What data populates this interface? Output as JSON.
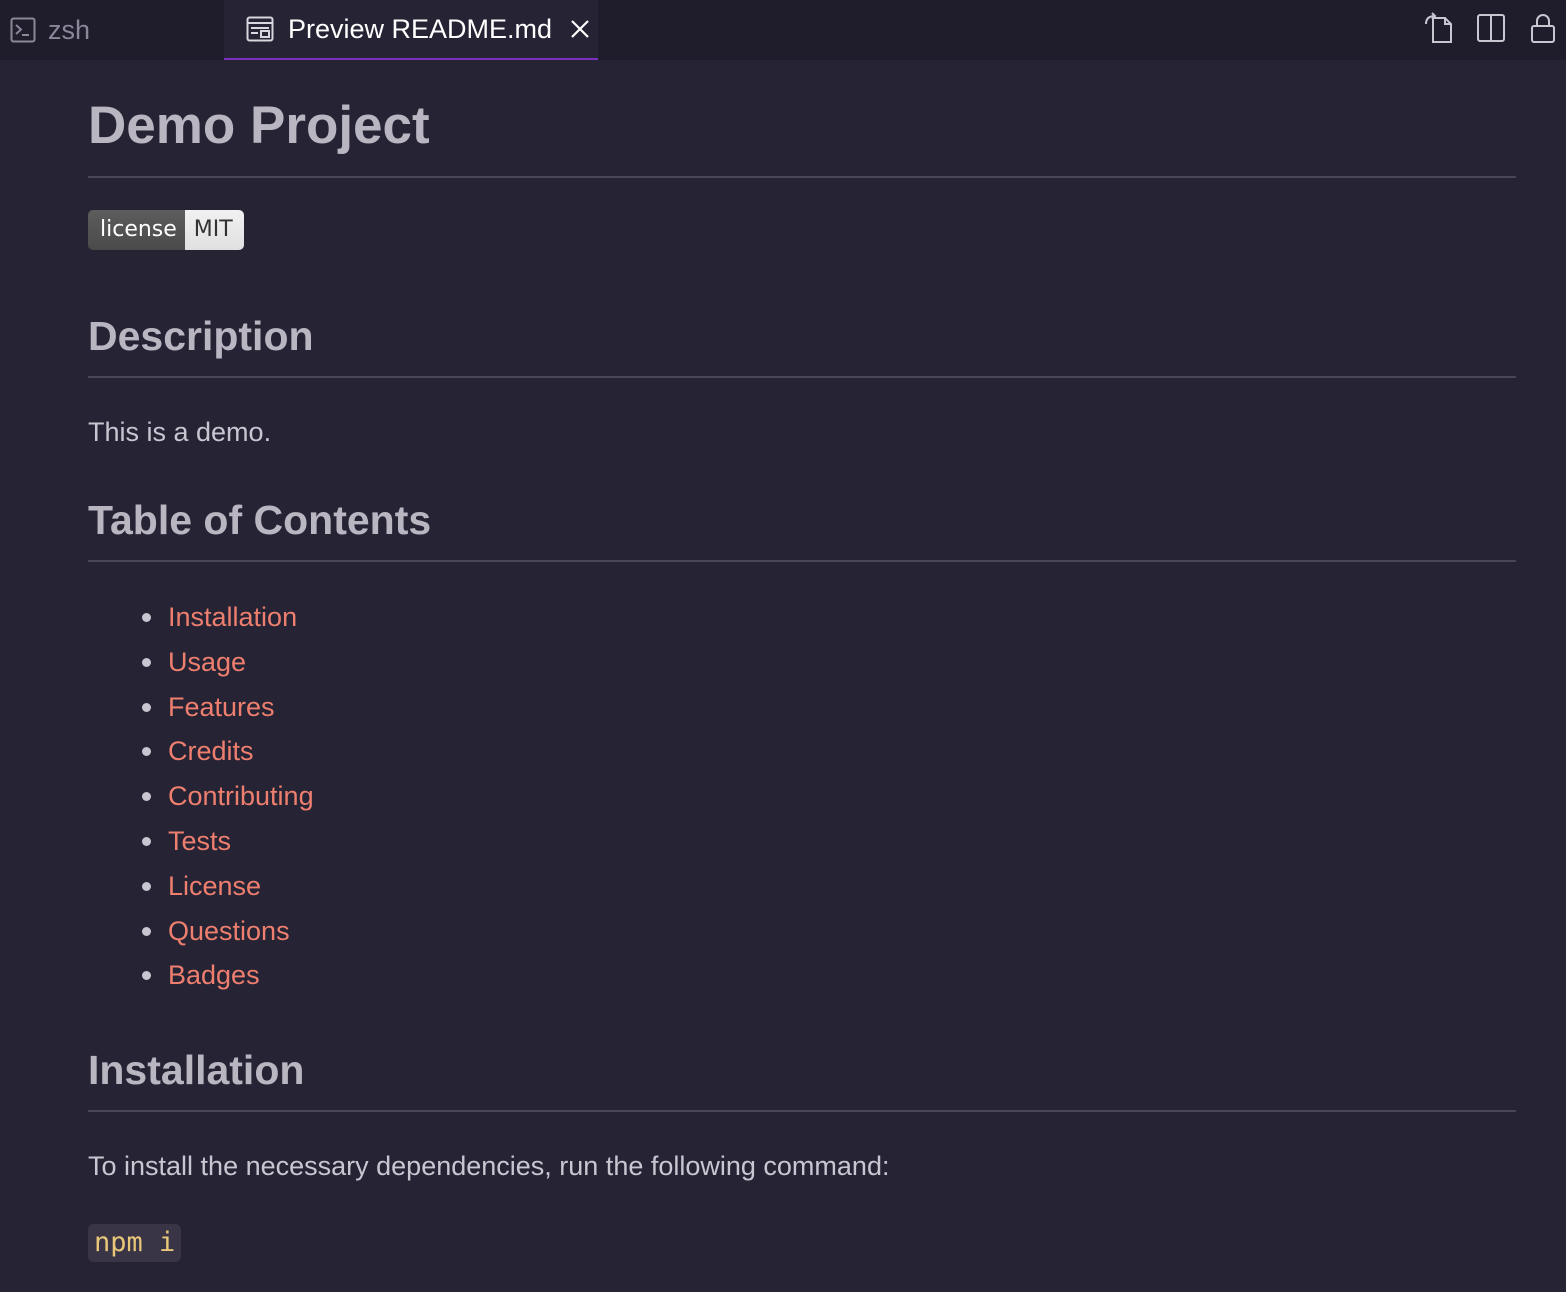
{
  "tabs": [
    {
      "label": "zsh",
      "icon": "terminal-icon",
      "active": false
    },
    {
      "label": "Preview README.md",
      "icon": "preview-icon",
      "active": true
    }
  ],
  "toolbar": {
    "actions": [
      "open-source-icon",
      "split-editor-icon",
      "lock-icon"
    ]
  },
  "colors": {
    "background": "#262335",
    "tabbar": "#1f1c2c",
    "active_tab_border": "#7b2fbe",
    "link": "#ee7f6e",
    "heading": "#b9b6c2",
    "code": "#e8c77a"
  },
  "document": {
    "title": "Demo Project",
    "badge": {
      "label": "license",
      "value": "MIT"
    },
    "sections": {
      "description": {
        "heading": "Description",
        "text": "This is a demo."
      },
      "toc": {
        "heading": "Table of Contents",
        "items": [
          "Installation",
          "Usage",
          "Features",
          "Credits",
          "Contributing",
          "Tests",
          "License",
          "Questions",
          "Badges"
        ]
      },
      "installation": {
        "heading": "Installation",
        "text": "To install the necessary dependencies, run the following command:",
        "code": "npm i"
      }
    }
  }
}
